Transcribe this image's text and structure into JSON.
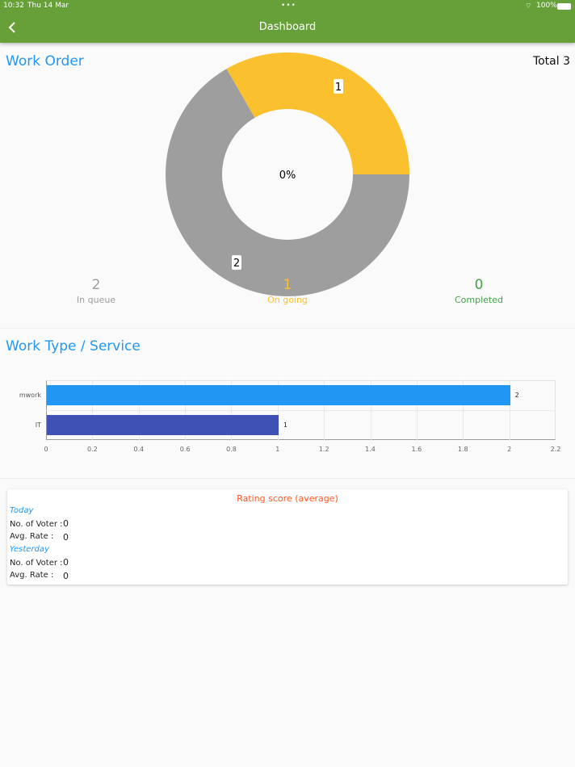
{
  "status": {
    "time": "10:32",
    "date": "Thu 14 Mar",
    "battery": "100%"
  },
  "header": {
    "title": "Dashboard",
    "back_icon": "chevron-left-icon"
  },
  "work_order": {
    "title": "Work Order",
    "total": "Total 3",
    "center_label": "0%",
    "stats": [
      {
        "value": "2",
        "label": "In queue",
        "color": "#9e9e9e"
      },
      {
        "value": "1",
        "label": "On going",
        "color": "#fbc02d"
      },
      {
        "value": "0",
        "label": "Completed",
        "color": "#43a047"
      }
    ]
  },
  "chart_data": [
    {
      "type": "pie",
      "donut": true,
      "title": "Work Order",
      "center_label": "0%",
      "slices": [
        {
          "name": "On going",
          "value": 1,
          "color": "#fbc02d",
          "label": "1"
        },
        {
          "name": "In queue",
          "value": 2,
          "color": "#9e9e9e",
          "label": "2"
        },
        {
          "name": "Completed",
          "value": 0,
          "color": "#43a047",
          "label": "0"
        }
      ]
    },
    {
      "type": "bar",
      "orientation": "horizontal",
      "title": "Work Type / Service",
      "categories": [
        "mwork",
        "IT"
      ],
      "values": [
        2,
        1
      ],
      "value_labels": [
        "2",
        "1"
      ],
      "colors": [
        "#2196f3",
        "#3f51b5"
      ],
      "xlim": [
        0,
        2.2
      ],
      "xticks": [
        "0",
        "0.2",
        "0.4",
        "0.6",
        "0.8",
        "1",
        "1.2",
        "1.4",
        "1.6",
        "1.8",
        "2",
        "2.2"
      ],
      "grid": true
    }
  ],
  "work_type": {
    "title": "Work Type / Service"
  },
  "rating": {
    "title": "Rating score (average)",
    "days": [
      {
        "label": "Today",
        "voter_label": "No. of Voter :",
        "voter": "0",
        "avg_label": "Avg. Rate :",
        "avg": "0"
      },
      {
        "label": "Yesterday",
        "voter_label": "No. of Voter :",
        "voter": "0",
        "avg_label": "Avg. Rate :",
        "avg": "0"
      }
    ]
  }
}
